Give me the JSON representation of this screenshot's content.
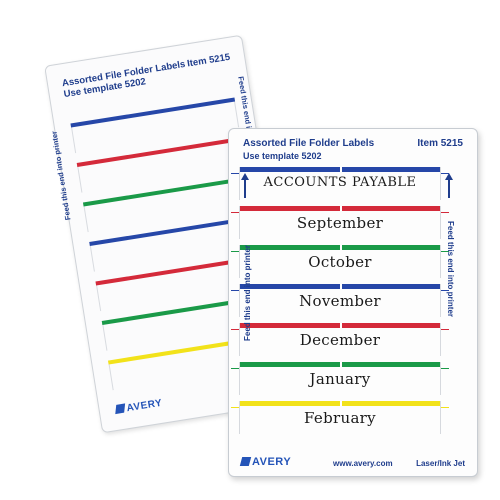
{
  "back_sheet": {
    "title": "Assorted File Folder Labels",
    "item": "Item 5215",
    "template": "Use template 5202",
    "feed_text": "Feed this end into printer",
    "feed_text_right": "Feed this end into printer",
    "logo": "AVERY",
    "strip_colors": [
      "#2647a8",
      "#d42a3a",
      "#1a9a48",
      "#2647a8",
      "#d42a3a",
      "#1a9a48",
      "#f2e21a"
    ]
  },
  "front_sheet": {
    "title": "Assorted File Folder Labels",
    "item": "Item 5215",
    "template": "Use template 5202",
    "feed_text": "Feed this end into printer",
    "feed_text_right": "Feed this end into printer",
    "logo": "AVERY",
    "website": "www.avery.com",
    "printer_type": "Laser/Ink Jet",
    "labels": [
      {
        "text": "ACCOUNTS PAYABLE",
        "color": "#2647a8"
      },
      {
        "text": "September",
        "color": "#d42a3a"
      },
      {
        "text": "October",
        "color": "#1a9a48"
      },
      {
        "text": "November",
        "color": "#2647a8"
      },
      {
        "text": "December",
        "color": "#d42a3a"
      },
      {
        "text": "January",
        "color": "#1a9a48"
      },
      {
        "text": "February",
        "color": "#f2e21a"
      }
    ]
  }
}
